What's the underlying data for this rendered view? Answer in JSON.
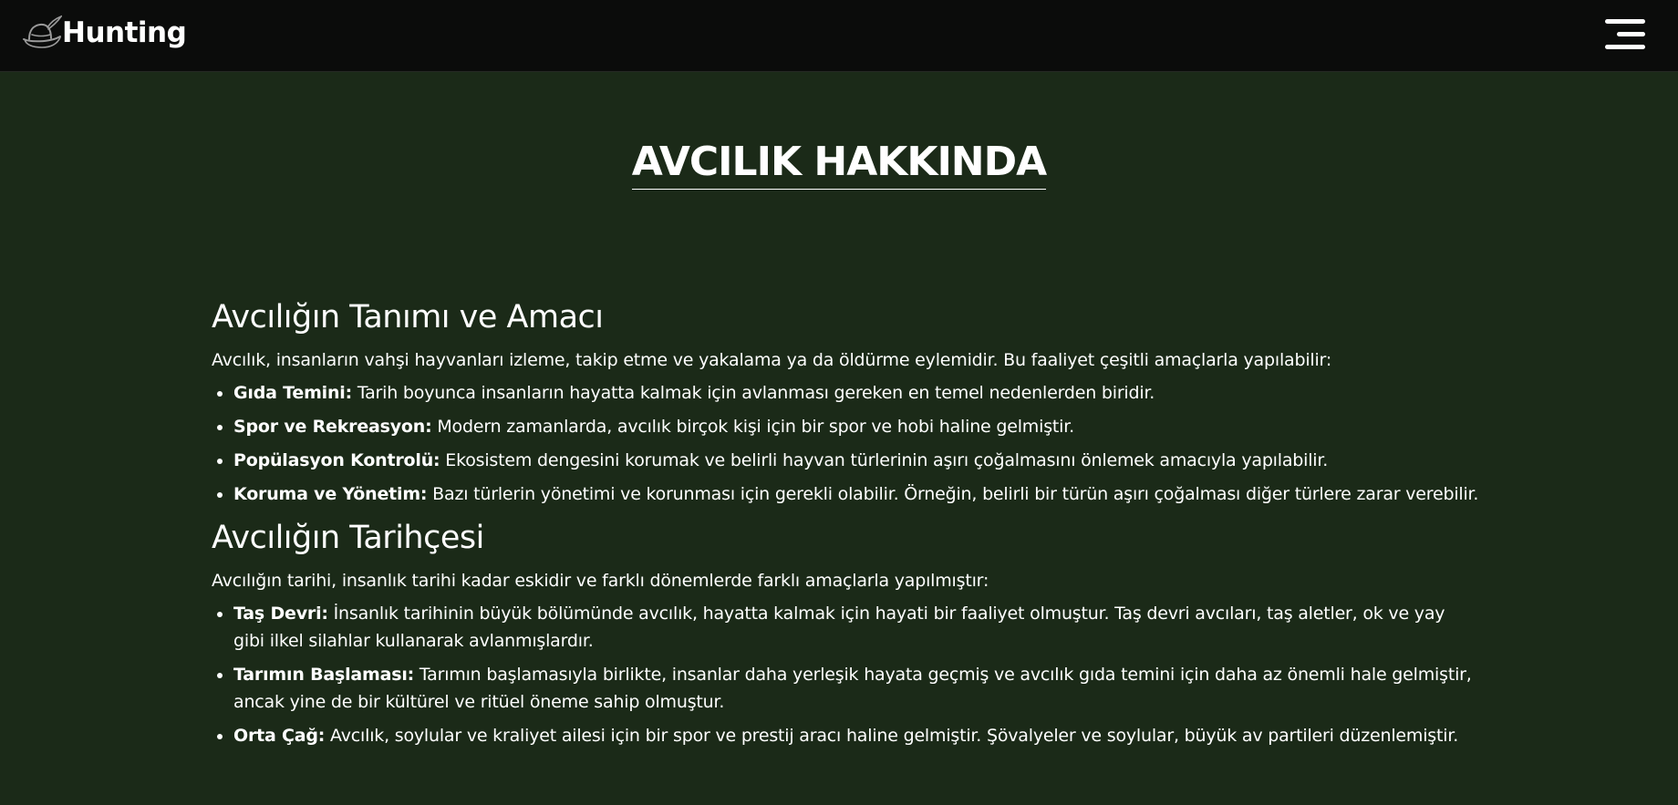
{
  "navbar": {
    "brand": "Hunting",
    "brand_icon": "hunting-hat-icon",
    "menu_icon": "hamburger-menu-icon"
  },
  "page": {
    "title": "AVCILIK HAKKINDA"
  },
  "sections": [
    {
      "heading": "Avcılığın Tanımı ve Amacı",
      "intro": "Avcılık, insanların vahşi hayvanları izleme, takip etme ve yakalama ya da öldürme eylemidir. Bu faaliyet çeşitli amaçlarla yapılabilir:",
      "items": [
        {
          "label": "Gıda Temini:",
          "text": " Tarih boyunca insanların hayatta kalmak için avlanması gereken en temel nedenlerden biridir."
        },
        {
          "label": "Spor ve Rekreasyon:",
          "text": " Modern zamanlarda, avcılık birçok kişi için bir spor ve hobi haline gelmiştir."
        },
        {
          "label": "Popülasyon Kontrolü:",
          "text": " Ekosistem dengesini korumak ve belirli hayvan türlerinin aşırı çoğalmasını önlemek amacıyla yapılabilir."
        },
        {
          "label": "Koruma ve Yönetim:",
          "text": " Bazı türlerin yönetimi ve korunması için gerekli olabilir. Örneğin, belirli bir türün aşırı çoğalması diğer türlere zarar verebilir."
        }
      ]
    },
    {
      "heading": "Avcılığın Tarihçesi",
      "intro": "Avcılığın tarihi, insanlık tarihi kadar eskidir ve farklı dönemlerde farklı amaçlarla yapılmıştır:",
      "items": [
        {
          "label": "Taş Devri:",
          "text": " İnsanlık tarihinin büyük bölümünde avcılık, hayatta kalmak için hayati bir faaliyet olmuştur. Taş devri avcıları, taş aletler, ok ve yay gibi ilkel silahlar kullanarak avlanmışlardır."
        },
        {
          "label": "Tarımın Başlaması:",
          "text": " Tarımın başlamasıyla birlikte, insanlar daha yerleşik hayata geçmiş ve avcılık gıda temini için daha az önemli hale gelmiştir, ancak yine de bir kültürel ve ritüel öneme sahip olmuştur."
        },
        {
          "label": "Orta Çağ:",
          "text": " Avcılık, soylular ve kraliyet ailesi için bir spor ve prestij aracı haline gelmiştir. Şövalyeler ve soylular, büyük av partileri düzenlemiştir."
        }
      ]
    }
  ]
}
